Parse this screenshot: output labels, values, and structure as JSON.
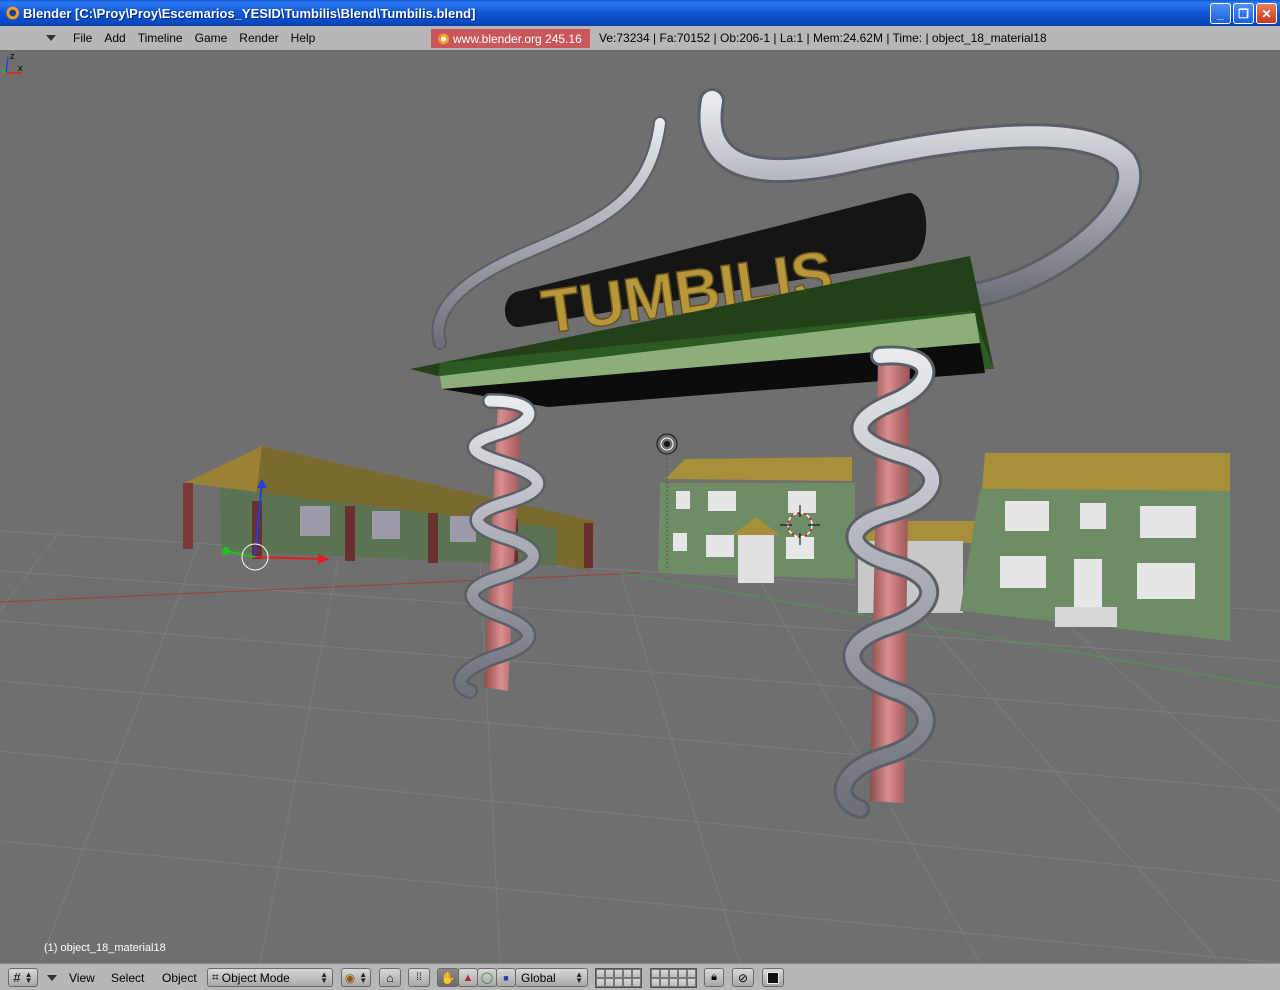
{
  "window": {
    "title": "Blender [C:\\Proy\\Proy\\Escemarios_YESID\\Tumbilis\\Blend\\Tumbilis.blend]",
    "controls": {
      "minimize": "_",
      "maximize": "❐",
      "close": "✕"
    }
  },
  "top_header": {
    "menus": [
      "File",
      "Add",
      "Timeline",
      "Game",
      "Render",
      "Help"
    ],
    "blender_link": "www.blender.org 245.16",
    "stats": "Ve:73234 | Fa:70152 | Ob:206-1 | La:1  | Mem:24.62M  | Time: | object_18_material18"
  },
  "viewport": {
    "sign_text": "TUMBILIS",
    "object_info": "(1) object_18_material18",
    "mini_axis": {
      "z_label": "z",
      "x_label": "x"
    }
  },
  "bottom_header": {
    "menus": [
      "View",
      "Select",
      "Object"
    ],
    "mode": "Object Mode",
    "orientation": "Global"
  },
  "colors": {
    "viewport_bg": "#6f6f6f",
    "header_bg": "#b7b7b7",
    "sign_text": "#b8963a",
    "post": "#c87878",
    "spiral": "#b8bcc4",
    "green_beam": "#2c5020",
    "house_wall": "#6e8c66",
    "roof": "#a88f3a"
  }
}
